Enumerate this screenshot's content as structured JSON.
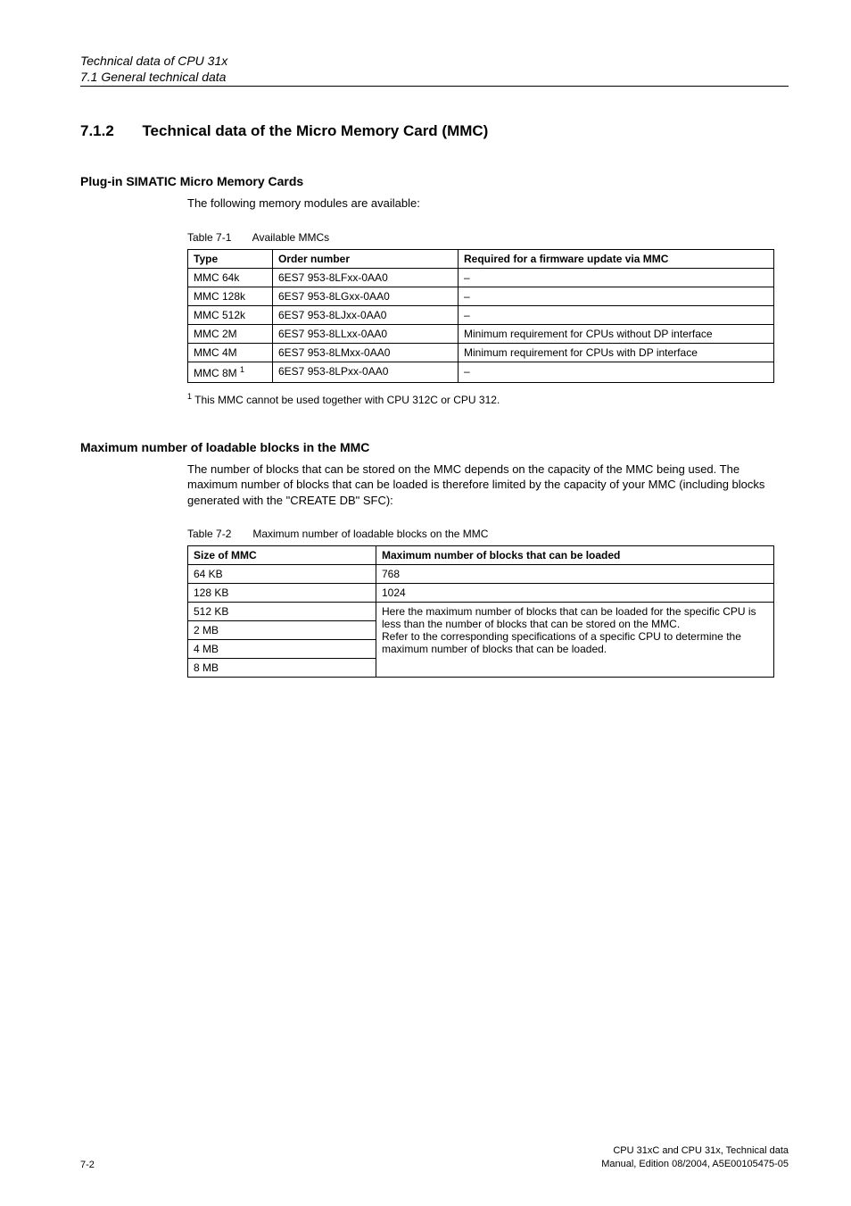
{
  "header": {
    "chapter": "Technical data of CPU 31x",
    "section": "7.1 General technical data"
  },
  "section": {
    "number": "7.1.2",
    "title": "Technical data of the Micro Memory Card (MMC)"
  },
  "sub1": {
    "heading": "Plug-in SIMATIC Micro Memory Cards",
    "intro": "The following memory modules are available:",
    "caption_label": "Table 7-1",
    "caption_text": "Available MMCs",
    "th1": "Type",
    "th2": "Order number",
    "th3": "Required for a firmware update via MMC",
    "rows": [
      {
        "type": "MMC 64k",
        "order": "6ES7 953-8LFxx-0AA0",
        "req": "–"
      },
      {
        "type": "MMC 128k",
        "order": "6ES7 953-8LGxx-0AA0",
        "req": "–"
      },
      {
        "type": "MMC 512k",
        "order": "6ES7 953-8LJxx-0AA0",
        "req": "–"
      },
      {
        "type": "MMC 2M",
        "order": "6ES7 953-8LLxx-0AA0",
        "req": "Minimum requirement for CPUs without DP interface"
      },
      {
        "type": "MMC 4M",
        "order": "6ES7 953-8LMxx-0AA0",
        "req": "Minimum requirement for CPUs with DP interface"
      },
      {
        "type": "MMC 8M ",
        "sup": "1",
        "order": "6ES7 953-8LPxx-0AA0",
        "req": "–"
      }
    ],
    "footnote_sup": "1",
    "footnote": " This MMC cannot be used together with CPU 312C or CPU 312."
  },
  "sub2": {
    "heading": "Maximum number of loadable blocks in the MMC",
    "intro": "The number of blocks that can be stored on the MMC depends on the capacity of the MMC being used. The maximum number of blocks that can be loaded is therefore limited by the capacity of your MMC (including blocks generated with the \"CREATE DB\" SFC):",
    "caption_label": "Table 7-2",
    "caption_text": "Maximum number of loadable blocks on the MMC",
    "th1": "Size of MMC",
    "th2": "Maximum number of blocks that can be loaded",
    "row1_size": "64 KB",
    "row1_val": "768",
    "row2_size": "128 KB",
    "row2_val": "1024",
    "row3_size": "512 KB",
    "row4_size": "2 MB",
    "row5_size": "4 MB",
    "row6_size": "8 MB",
    "merged_text_line1": "Here the maximum number of blocks that can be loaded for the specific CPU is less than the number of blocks that can be stored on the MMC.",
    "merged_text_line2": "Refer to the corresponding specifications of a specific CPU to determine the maximum number of blocks that can be loaded."
  },
  "footer": {
    "page": "7-2",
    "line1": "CPU 31xC and CPU 31x, Technical data",
    "line2": "Manual, Edition 08/2004, A5E00105475-05"
  }
}
